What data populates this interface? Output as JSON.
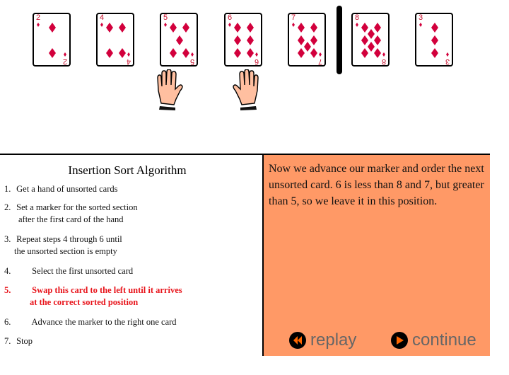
{
  "cards": [
    {
      "rank": "2",
      "suit": "diamonds"
    },
    {
      "rank": "4",
      "suit": "diamonds"
    },
    {
      "rank": "5",
      "suit": "diamonds"
    },
    {
      "rank": "6",
      "suit": "diamonds"
    },
    {
      "rank": "7",
      "suit": "diamonds"
    },
    {
      "rank": "8",
      "suit": "diamonds"
    },
    {
      "rank": "3",
      "suit": "diamonds"
    }
  ],
  "icons": {
    "marker": "sorted-section-marker",
    "hand": "hand-icon",
    "replay": "rewind-icon",
    "continue": "play-icon"
  },
  "colors": {
    "card_red": "#d2003c",
    "panel_orange": "#ff9966",
    "active_step": "#e8141b",
    "button_text": "#666666"
  },
  "algorithm": {
    "title": "Insertion Sort Algorithm",
    "steps": [
      {
        "num": "1.",
        "lines": [
          "Get a hand of unsorted cards"
        ]
      },
      {
        "num": "2.",
        "lines": [
          "Set a marker for the sorted section",
          "after the first card of the hand"
        ]
      },
      {
        "num": "3.",
        "lines": [
          "Repeat steps 4 through 6 until",
          "the unsorted section is empty"
        ]
      },
      {
        "num": "4.",
        "lines": [
          "Select the first unsorted card"
        ]
      },
      {
        "num": "5.",
        "lines": [
          "Swap this card to the left until it arrives",
          "at the correct sorted position"
        ]
      },
      {
        "num": "6.",
        "lines": [
          "Advance the marker to the right one card"
        ]
      },
      {
        "num": "7.",
        "lines": [
          "Stop"
        ]
      }
    ],
    "active_step": "5."
  },
  "description": "Now we advance our marker and order the next unsorted card.  6 is less than 8 and 7, but greater than 5, so we leave it in this position.",
  "buttons": {
    "replay": "replay",
    "continue": "continue"
  }
}
